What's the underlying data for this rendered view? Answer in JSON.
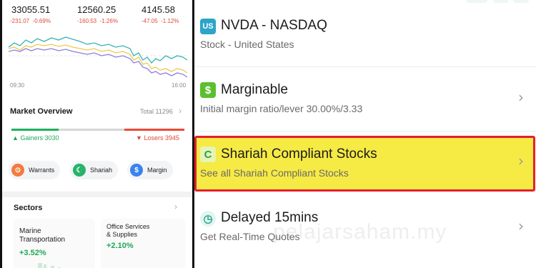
{
  "market": {
    "indices": [
      {
        "value": "33055.51",
        "change": "-231.07",
        "pct": "-0.69%"
      },
      {
        "value": "12560.25",
        "change": "-160.53",
        "pct": "-1.26%"
      },
      {
        "value": "4145.58",
        "change": "-47.05",
        "pct": "-1.12%"
      }
    ],
    "time_start": "09:30",
    "time_end": "16:00",
    "series_colors": [
      "#35b3b4",
      "#f2c84b",
      "#8a7fe0"
    ]
  },
  "overview": {
    "title": "Market Overview",
    "total": "Total 11296",
    "gainers_label": "Gainers 3030",
    "losers_label": "Losers 3945",
    "gainers_color": "#1fa857",
    "losers_color": "#e0483a"
  },
  "chips": [
    {
      "label": "Warrants",
      "icon": "warrants-icon",
      "color": "#f47a3d"
    },
    {
      "label": "Shariah",
      "icon": "crescent-icon",
      "color": "#27b36b"
    },
    {
      "label": "Margin",
      "icon": "dollar-icon",
      "color": "#3a82f0"
    }
  ],
  "sectors": {
    "title": "Sectors",
    "items": [
      {
        "name_line1": "Marine",
        "name_line2": "Transportation",
        "pct": "+3.52%"
      },
      {
        "name_line1": "Office Services",
        "name_line2": "& Supplies",
        "pct": "+2.10%"
      }
    ]
  },
  "list": {
    "rows": [
      {
        "icon_text": "US",
        "title": "NVDA - NASDAQ",
        "sub": "Stock - United States"
      },
      {
        "icon_text": "$",
        "title": "Marginable",
        "sub": "Initial margin ratio/lever 30.00%/3.33"
      },
      {
        "icon_text": "C",
        "title": "Shariah Compliant Stocks",
        "sub": "See all Shariah Compliant Stocks"
      },
      {
        "icon_text": "◷",
        "title": "Delayed 15mins",
        "sub": "Get Real-Time Quotes"
      }
    ],
    "highlight_color": "#f6ea44",
    "highlight_border": "#e2202c",
    "watermark": "pelajarsaham.my"
  }
}
